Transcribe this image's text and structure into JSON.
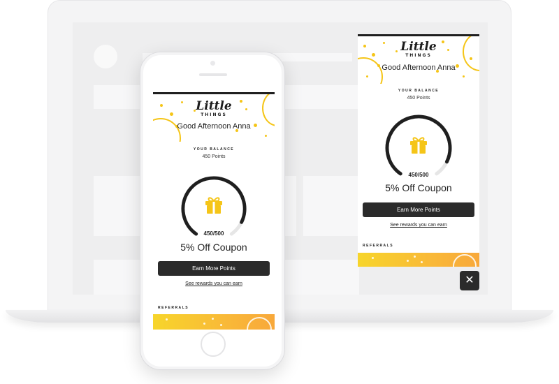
{
  "brand": {
    "line1": "Little",
    "line2": "THINGS"
  },
  "greeting": "Good Afternoon Anna",
  "balance": {
    "label": "YOUR BALANCE",
    "value": "450 Points"
  },
  "progress": {
    "current": 450,
    "target": 500,
    "fraction": 0.9,
    "text": "450/500"
  },
  "reward": {
    "title": "5% Off Coupon"
  },
  "actions": {
    "earn_label": "Earn More Points",
    "rewards_link": "See rewards you can earn"
  },
  "referrals": {
    "label": "REFERRALS"
  },
  "close": {
    "glyph": "✕"
  },
  "icons": {
    "gift": "gift-icon",
    "close": "close-icon"
  },
  "colors": {
    "accent": "#f5c518",
    "dark": "#2b2b2b",
    "track": "#e6e6e6",
    "ring": "#1f1f1f"
  }
}
